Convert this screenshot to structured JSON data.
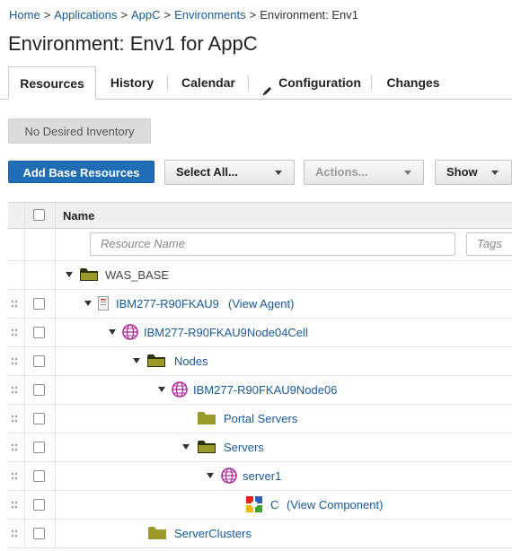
{
  "breadcrumb": {
    "items": [
      "Home",
      "Applications",
      "AppC",
      "Environments"
    ],
    "current": "Environment: Env1",
    "separator": ">"
  },
  "page_title": "Environment: Env1 for AppC",
  "tabs": [
    {
      "label": "Resources",
      "active": true
    },
    {
      "label": "History"
    },
    {
      "label": "Calendar"
    },
    {
      "label": "Configuration",
      "icon": "pencil-icon"
    },
    {
      "label": "Changes"
    }
  ],
  "buttons": {
    "no_desired_inventory": "No Desired Inventory",
    "add_base_resources": "Add Base Resources",
    "select_all": "Select All...",
    "actions": "Actions...",
    "show": "Show"
  },
  "grid": {
    "header_name": "Name",
    "filter_placeholder": "Resource Name",
    "tags_placeholder": "Tags"
  },
  "tree": [
    {
      "label": "WAS_BASE",
      "icon": "folder-icon",
      "expanded": true,
      "link": false
    },
    {
      "label": "IBM277-R90FKAU9",
      "extra": "(View Agent)",
      "icon": "agent-icon",
      "expanded": true,
      "link": true
    },
    {
      "label": "IBM277-R90FKAU9Node04Cell",
      "icon": "globe-icon",
      "expanded": true,
      "link": true
    },
    {
      "label": "Nodes",
      "icon": "folder-icon",
      "expanded": true,
      "link": true
    },
    {
      "label": "IBM277-R90FKAU9Node06",
      "icon": "globe-icon",
      "expanded": true,
      "link": true
    },
    {
      "label": "Portal Servers",
      "icon": "folder-icon",
      "expanded": false,
      "link": true
    },
    {
      "label": "Servers",
      "icon": "folder-icon",
      "expanded": true,
      "link": true
    },
    {
      "label": "server1",
      "icon": "globe-icon",
      "expanded": true,
      "link": true
    },
    {
      "label": "C",
      "extra": "(View Component)",
      "icon": "component-icon",
      "link": true
    },
    {
      "label": "ServerClusters",
      "icon": "folder-icon",
      "link": true
    }
  ],
  "colors": {
    "link": "#1a5a96",
    "primary_button": "#1f6db5",
    "folder": "#9a9a2a",
    "globe": "#b0309a"
  }
}
